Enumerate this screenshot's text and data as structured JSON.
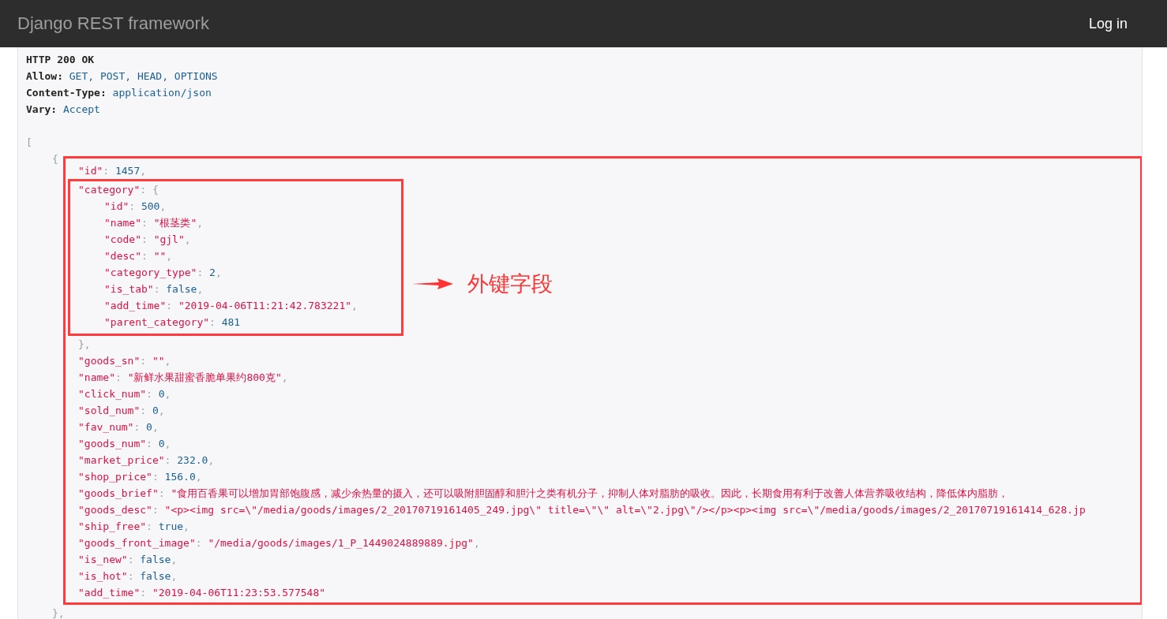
{
  "navbar": {
    "brand": "Django REST framework",
    "login": "Log in"
  },
  "response": {
    "status": "HTTP 200 OK",
    "headers": [
      {
        "name": "Allow:",
        "value": "GET, POST, HEAD, OPTIONS"
      },
      {
        "name": "Content-Type:",
        "value": "application/json"
      },
      {
        "name": "Vary:",
        "value": "Accept"
      }
    ],
    "body": {
      "open": "[",
      "children": [
        {
          "open": "{",
          "children_highlighted": true,
          "close": "},",
          "children": [
            {
              "key": "\"id\"",
              "colon": ":",
              "value": "1457",
              "kind": "number",
              "comma": ","
            },
            {
              "key": "\"category\"",
              "colon": ":",
              "open": "{",
              "highlighted": true,
              "annotation": "外键字段",
              "close": "},",
              "children": [
                {
                  "key": "\"id\"",
                  "colon": ":",
                  "value": "500",
                  "kind": "number",
                  "comma": ","
                },
                {
                  "key": "\"name\"",
                  "colon": ":",
                  "value": "\"根茎类\"",
                  "kind": "string",
                  "comma": ","
                },
                {
                  "key": "\"code\"",
                  "colon": ":",
                  "value": "\"gjl\"",
                  "kind": "string",
                  "comma": ","
                },
                {
                  "key": "\"desc\"",
                  "colon": ":",
                  "value": "\"\"",
                  "kind": "string",
                  "comma": ","
                },
                {
                  "key": "\"category_type\"",
                  "colon": ":",
                  "value": "2",
                  "kind": "number",
                  "comma": ","
                },
                {
                  "key": "\"is_tab\"",
                  "colon": ":",
                  "value": "false",
                  "kind": "literal",
                  "comma": ","
                },
                {
                  "key": "\"add_time\"",
                  "colon": ":",
                  "value": "\"2019-04-06T11:21:42.783221\"",
                  "kind": "string",
                  "comma": ","
                },
                {
                  "key": "\"parent_category\"",
                  "colon": ":",
                  "value": "481",
                  "kind": "number"
                }
              ]
            },
            {
              "key": "\"goods_sn\"",
              "colon": ":",
              "value": "\"\"",
              "kind": "string",
              "comma": ","
            },
            {
              "key": "\"name\"",
              "colon": ":",
              "value": "\"新鲜水果甜蜜香脆单果约800克\"",
              "kind": "string",
              "comma": ","
            },
            {
              "key": "\"click_num\"",
              "colon": ":",
              "value": "0",
              "kind": "number",
              "comma": ","
            },
            {
              "key": "\"sold_num\"",
              "colon": ":",
              "value": "0",
              "kind": "number",
              "comma": ","
            },
            {
              "key": "\"fav_num\"",
              "colon": ":",
              "value": "0",
              "kind": "number",
              "comma": ","
            },
            {
              "key": "\"goods_num\"",
              "colon": ":",
              "value": "0",
              "kind": "number",
              "comma": ","
            },
            {
              "key": "\"market_price\"",
              "colon": ":",
              "value": "232.0",
              "kind": "number",
              "comma": ","
            },
            {
              "key": "\"shop_price\"",
              "colon": ":",
              "value": "156.0",
              "kind": "number",
              "comma": ","
            },
            {
              "key": "\"goods_brief\"",
              "colon": ":",
              "value": "\"食用百香果可以增加胃部饱腹感，减少余热量的摄入，还可以吸附胆固醇和胆汁之类有机分子，抑制人体对脂肪的吸收。因此，长期食用有利于改善人体营养吸收结构，降低体内脂肪，",
              "kind": "string"
            },
            {
              "key": "\"goods_desc\"",
              "colon": ":",
              "value": "\"<p><img src=\\\"/media/goods/images/2_20170719161405_249.jpg\\\" title=\\\"\\\" alt=\\\"2.jpg\\\"/></p><p><img src=\\\"/media/goods/images/2_20170719161414_628.jp",
              "kind": "string"
            },
            {
              "key": "\"ship_free\"",
              "colon": ":",
              "value": "true",
              "kind": "literal",
              "comma": ","
            },
            {
              "key": "\"goods_front_image\"",
              "colon": ":",
              "value": "\"/media/goods/images/1_P_1449024889889.jpg\"",
              "kind": "string",
              "comma": ","
            },
            {
              "key": "\"is_new\"",
              "colon": ":",
              "value": "false",
              "kind": "literal",
              "comma": ","
            },
            {
              "key": "\"is_hot\"",
              "colon": ":",
              "value": "false",
              "kind": "literal",
              "comma": ","
            },
            {
              "key": "\"add_time\"",
              "colon": ":",
              "value": "\"2019-04-06T11:23:53.577548\"",
              "kind": "string"
            }
          ]
        }
      ]
    }
  }
}
